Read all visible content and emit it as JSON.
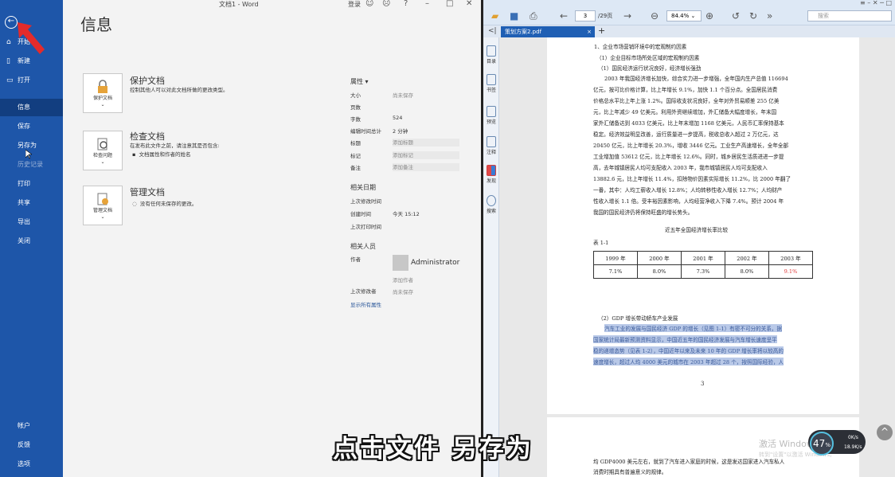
{
  "word": {
    "window_title": "文档1 - Word",
    "login": "登录",
    "help": "?",
    "page_title": "信息",
    "nav": {
      "home": "开始",
      "new": "新建",
      "open": "打开",
      "info": "信息",
      "save": "保存",
      "save_as": "另存为",
      "history": "历史记录",
      "print": "打印",
      "share": "共享",
      "export": "导出",
      "close": "关闭",
      "account": "帐户",
      "feedback": "反馈",
      "options": "选项"
    },
    "protect": {
      "card": "保护文档",
      "title": "保护文档",
      "desc": "控制其他人可以对此文档所做的更改类型。"
    },
    "inspect": {
      "card": "检查问题",
      "title": "检查文档",
      "desc": "在发布此文件之前，请注意其是否包含:",
      "bullet": "文档属性和作者的姓名"
    },
    "manage": {
      "card": "管理文档",
      "title": "管理文档",
      "desc": "没有任何未保存的更改。"
    },
    "properties": {
      "header": "属性 ▾",
      "size_label": "大小",
      "size_value": "尚未保存",
      "pages_label": "页数",
      "words_label": "字数",
      "words_value": "524",
      "edit_time_label": "编辑时间总计",
      "edit_time_value": "2 分钟",
      "title_label": "标题",
      "title_value": "添加标题",
      "tags_label": "标记",
      "tags_value": "添加标记",
      "comments_label": "备注",
      "comments_value": "添加备注"
    },
    "dates": {
      "header": "相关日期",
      "modified_label": "上次修改时间",
      "created_label": "创建时间",
      "created_value": "今天 15:12",
      "printed_label": "上次打印时间"
    },
    "people": {
      "header": "相关人员",
      "author_label": "作者",
      "author_name": "Administrator",
      "add_author": "添加作者",
      "last_modified_label": "上次修改者",
      "last_modified_value": "尚未保存",
      "show_all": "显示所有属性"
    }
  },
  "pdf": {
    "page_current": "3",
    "page_total": "/29页",
    "zoom": "84.4%",
    "search_placeholder": "搜索",
    "tab_name": "策划方案2.pdf",
    "sidebar": {
      "toc": "目录",
      "bookmarks": "书签",
      "preview": "预览",
      "notes": "注释",
      "discover": "发现",
      "search": "搜索"
    },
    "lines": {
      "l0": "1、企业市场营销环境中的宏观制约因素",
      "l1": "（1）企业目标市场所处区域的宏观制约因素",
      "l2": "（1）国民经济运行状况良好，经济增长强劲",
      "l3": "2003 年我国经济增长加快，综合实力进一步增强，全年国内生产总值 116694",
      "l4": "亿元，按可比价格计算，比上年增长 9.1%，加快 1.1 个百分点。全国居民消费",
      "l5": "价格总水平比上年上涨 1.2%。国际收支状况良好，全年对外贸易顺差 255 亿美",
      "l6": "元，比上年减少 49 亿美元。利用外资继续增加，外汇储备大幅度增长，年末国",
      "l7": "家外汇储备达到 4033 亿美元，比上年末增加 1168 亿美元，人民币汇率保持基本",
      "l8": "稳定。经济效益明显改善，运行质量进一步提高，税收总收入超过 2 万亿元，达",
      "l9": "20450 亿元，比上年增长 20.3%，增收 3446 亿元。工业生产高速增长，全年全部",
      "l10": "工业增加值 53612 亿元，比上年增长 12.6%。同时，城乡居民生活质进进一步提",
      "l11": "高，去年城镇居民人均可支配收入 2003 年，我市城镇居民人均可支配收入",
      "l12": "13882.6 元，比上年增长 11.4%，扣除物价因素实际增长 11.2%，比 2000 年翻了",
      "l13": "一番，其中：人均工薪收入增长 12.8%；人均转移性收入增长 12.7%；人均财产",
      "l14": "性收入增长 1.1 倍。受丰裕因素影响，人均经营净收入下降 7.4%。预计 2004 年",
      "l15": "我国的国民经济仍将保持旺盛的增长势头。",
      "table_caption": "近五年全国经济增长率比较",
      "table_label": "表 1-1",
      "s2": "（2）GDP 增长带动轿车产业发展",
      "h1": "汽车工业的发展与国民经济 GDP 的增长（见图 1-1）有密不可分的关系，据",
      "h2": "国家统计局最新预测资料显示，中国近五年的国民经济发展与汽车增长速度呈平",
      "h3": "稳的递增态势（见表 1-2），中国近年以来及未来 10 年的 GDP 增长率将以较高的",
      "h4": "速度增长，超过人均 4000 美元的城市在 2003 年超过 28 个，按照国际经验，人",
      "page_num": "3",
      "p2a": "均 GDP4000 美元左右，就到了汽车进入家庭的时候，这是发达国家进入汽车私人",
      "p2b": "消费时期具有普遍意义的规律。"
    },
    "table": {
      "years": [
        "1999 年",
        "2000 年",
        "2001 年",
        "2002 年",
        "2003 年"
      ],
      "rates": [
        "7.1%",
        "8.0%",
        "7.3%",
        "8.0%",
        "9.1%"
      ]
    }
  },
  "overlay": {
    "subtitle": "点击文件  另存为",
    "watermark": "激活 Windows",
    "watermark2": "转到\"设置\"以激活 Windows。",
    "speed_pct": "47",
    "speed_up": "0K/s",
    "speed_down": "18.9K/s"
  },
  "colors": {
    "word_blue": "#1e56a9",
    "pdf_tab_blue": "#1f5fb4",
    "highlight": "#b9c9e8",
    "table_red": "#e03a3a"
  }
}
